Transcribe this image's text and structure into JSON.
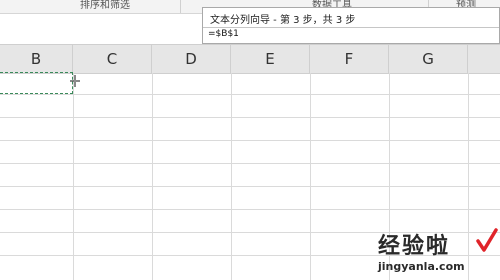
{
  "ribbon": {
    "groups": [
      "排序和筛选",
      "数据工具",
      "预测"
    ]
  },
  "columns": [
    "B",
    "C",
    "D",
    "E",
    "F",
    "G"
  ],
  "dialog": {
    "title": "文本分列向导 - 第 3 步，共 3 步",
    "destination_value": "=$B$1"
  },
  "watermark": {
    "text": "经验啦",
    "url": "jingyanla.com"
  },
  "colors": {
    "header_bg": "#e6e6e6",
    "marquee": "#3a8a5a",
    "check_mark": "#e0242a"
  }
}
